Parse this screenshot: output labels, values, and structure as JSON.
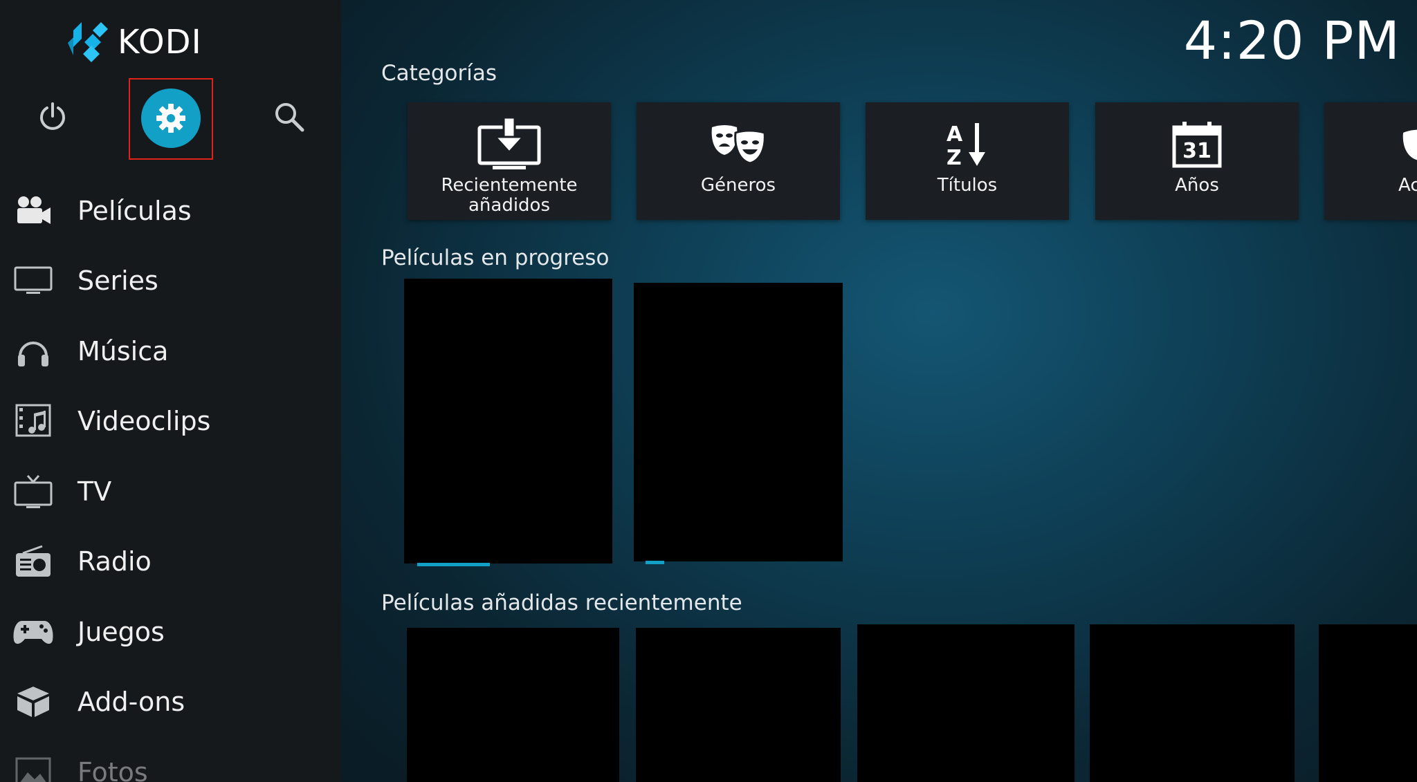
{
  "app": {
    "name": "KODI"
  },
  "clock": {
    "time": "4:20 PM"
  },
  "sidebar": {
    "top_buttons": [
      {
        "name": "power",
        "icon": "power-icon"
      },
      {
        "name": "settings",
        "icon": "gear-icon",
        "highlighted": true
      },
      {
        "name": "search",
        "icon": "search-icon"
      }
    ],
    "menu": [
      {
        "label": "Películas",
        "icon": "movie-camera-icon"
      },
      {
        "label": "Series",
        "icon": "tv-monitor-icon"
      },
      {
        "label": "Música",
        "icon": "headphones-icon"
      },
      {
        "label": "Videoclips",
        "icon": "music-video-icon"
      },
      {
        "label": "TV",
        "icon": "tv-antenna-icon"
      },
      {
        "label": "Radio",
        "icon": "radio-icon"
      },
      {
        "label": "Juegos",
        "icon": "gamepad-icon"
      },
      {
        "label": "Add-ons",
        "icon": "addons-box-icon"
      },
      {
        "label": "Fotos",
        "icon": "picture-icon"
      }
    ]
  },
  "main": {
    "categories": {
      "title": "Categorías",
      "items": [
        {
          "label": "Recientemente\nañadidos",
          "icon": "recently-added-icon"
        },
        {
          "label": "Géneros",
          "icon": "theater-masks-icon"
        },
        {
          "label": "Títulos",
          "icon": "sort-az-icon"
        },
        {
          "label": "Años",
          "icon": "calendar-icon",
          "icon_text": "31"
        },
        {
          "label": "Act",
          "icon": "actor-mask-icon"
        }
      ]
    },
    "in_progress": {
      "title": "Películas en progreso",
      "items": [
        {
          "progress": 0.35
        },
        {
          "progress": 0.09
        }
      ]
    },
    "recently_added": {
      "title": "Películas añadidas recientemente"
    }
  },
  "colors": {
    "accent": "#12a0c7",
    "highlight_border": "#e2231a",
    "sidebar_bg": "#16191c",
    "tile_bg": "#1b1f23"
  }
}
